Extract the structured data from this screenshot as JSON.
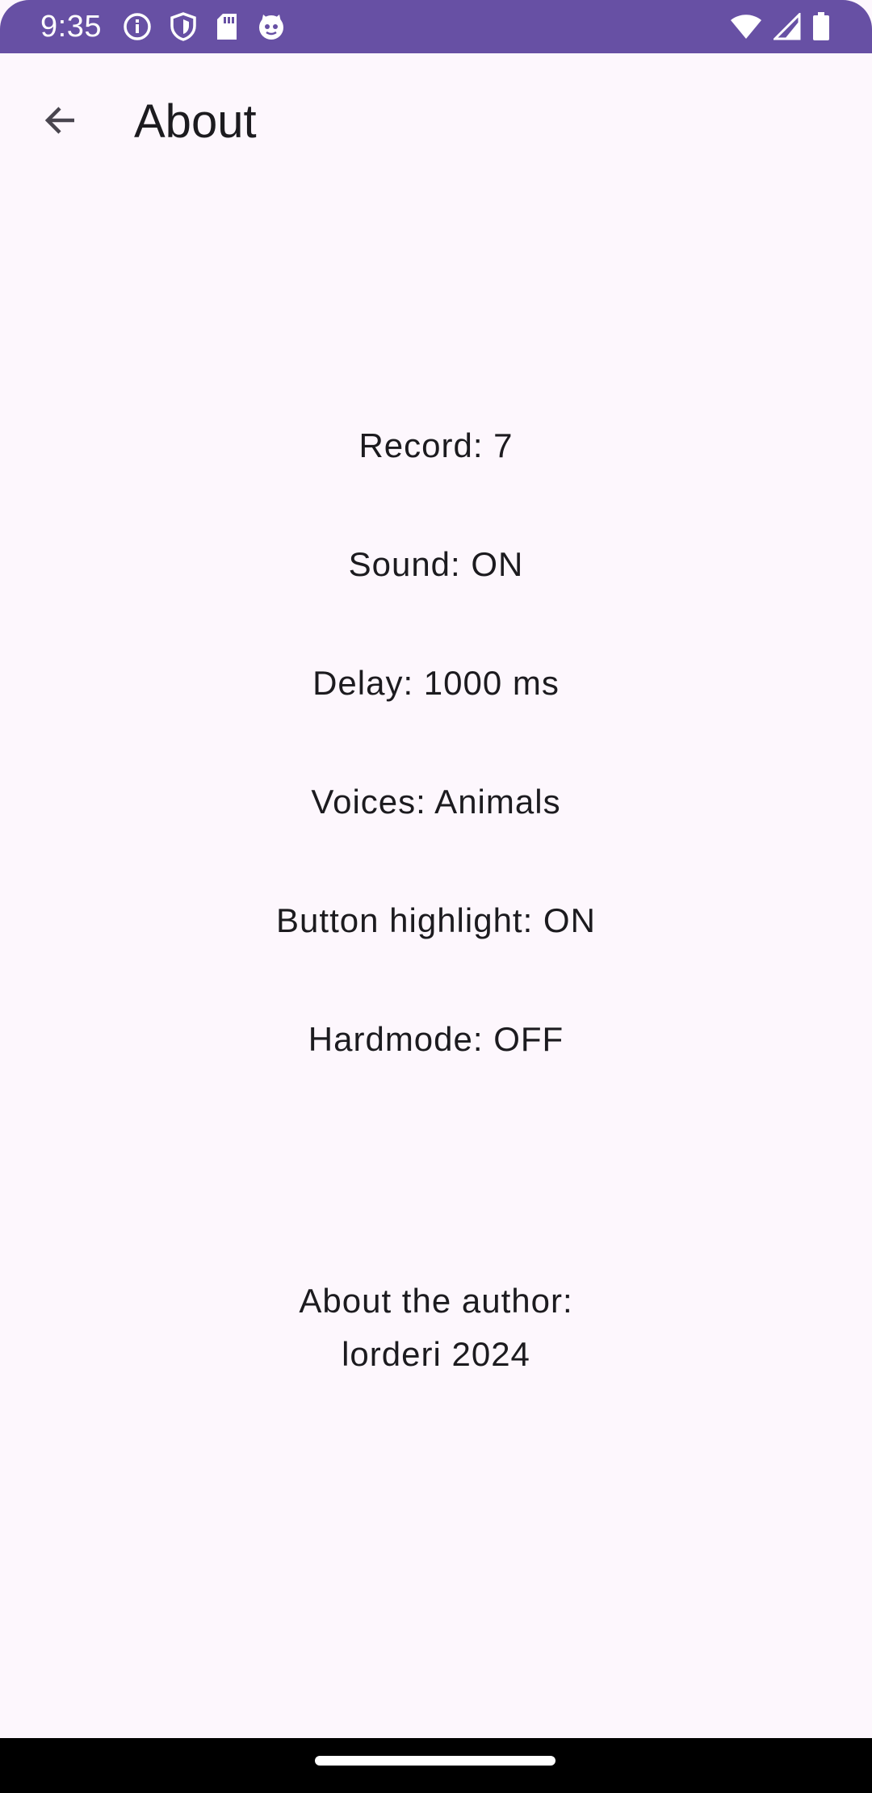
{
  "status_bar": {
    "time": "9:35",
    "background_color": "#6750a4",
    "left_icons": [
      "info-icon",
      "shield-icon",
      "sd-card-icon",
      "cat-face-icon"
    ],
    "right_icons": [
      "wifi-icon",
      "cellular-signal-icon",
      "battery-icon"
    ]
  },
  "app_bar": {
    "back_icon": "arrow-back-icon",
    "title": "About"
  },
  "settings": {
    "record": "Record: 7",
    "sound": "Sound: ON",
    "delay": "Delay: 1000 ms",
    "voices": "Voices: Animals",
    "button_highlight": "Button highlight: ON",
    "hardmode": "Hardmode: OFF"
  },
  "author": {
    "heading": "About the author:",
    "name": "lorderi 2024"
  },
  "nav_bar": {
    "handle": "home-handle"
  }
}
